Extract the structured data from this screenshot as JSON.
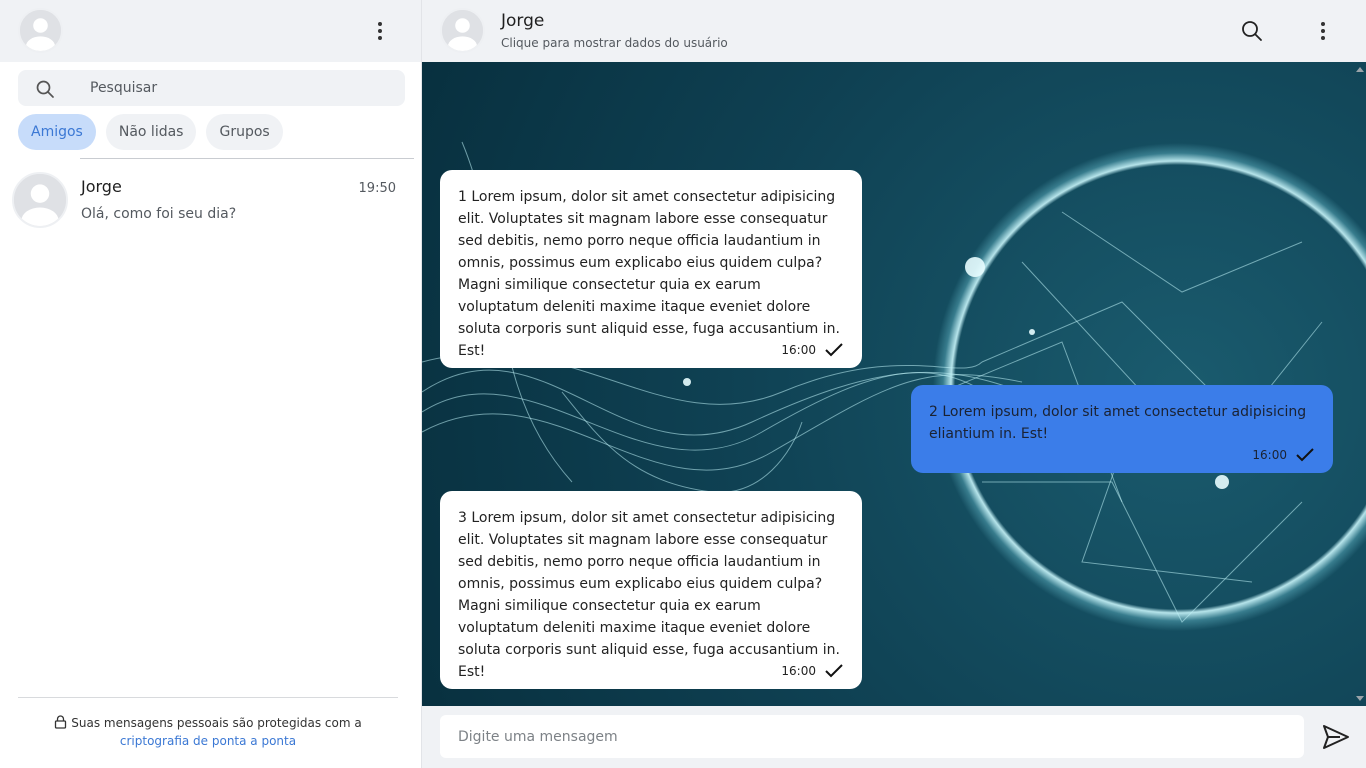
{
  "sidebar": {
    "search": {
      "placeholder": "Pesquisar"
    },
    "filters": [
      {
        "label": "Amigos",
        "active": true
      },
      {
        "label": "Não lidas",
        "active": false
      },
      {
        "label": "Grupos",
        "active": false
      }
    ],
    "chats": [
      {
        "name": "Jorge",
        "time": "19:50",
        "preview": "Olá, como foi seu dia?"
      }
    ],
    "footer": {
      "text": "Suas mensagens pessoais são protegidas com a",
      "link": "criptografia de ponta a ponta"
    }
  },
  "conversation": {
    "contact_name": "Jorge",
    "subtitle": "Clique para mostrar dados do usuário",
    "messages": [
      {
        "direction": "in",
        "text": "1 Lorem ipsum, dolor sit amet consectetur adipisicing elit. Voluptates sit magnam labore esse consequatur sed debitis, nemo porro neque officia laudantium in omnis, possimus eum explicabo eius quidem culpa? Magni similique consectetur quia ex earum voluptatum deleniti maxime itaque eveniet dolore soluta corporis sunt aliquid esse, fuga accusantium in. Est!",
        "time": "16:00"
      },
      {
        "direction": "out",
        "text": "2 Lorem ipsum, dolor sit amet consectetur adipisicing eliantium in. Est!",
        "time": "16:00"
      },
      {
        "direction": "in",
        "text": "3 Lorem ipsum, dolor sit amet consectetur adipisicing elit. Voluptates sit magnam labore esse consequatur sed debitis, nemo porro neque officia laudantium in omnis, possimus eum explicabo eius quidem culpa? Magni similique consectetur quia ex earum voluptatum deleniti maxime itaque eveniet dolore soluta corporis sunt aliquid esse, fuga accusantium in. Est!",
        "time": "16:00"
      }
    ],
    "composer": {
      "placeholder": "Digite uma mensagem"
    }
  },
  "icons": {
    "search": "search-icon",
    "menu": "kebab-menu-icon",
    "send": "send-icon",
    "check": "check-icon",
    "lock": "lock-icon",
    "avatar": "avatar-placeholder-icon"
  },
  "colors": {
    "accent": "#3b7de9",
    "chip_active_bg": "#c7dcfa",
    "chip_active_text": "#3b78d4",
    "panel_bg": "#f0f2f5"
  }
}
